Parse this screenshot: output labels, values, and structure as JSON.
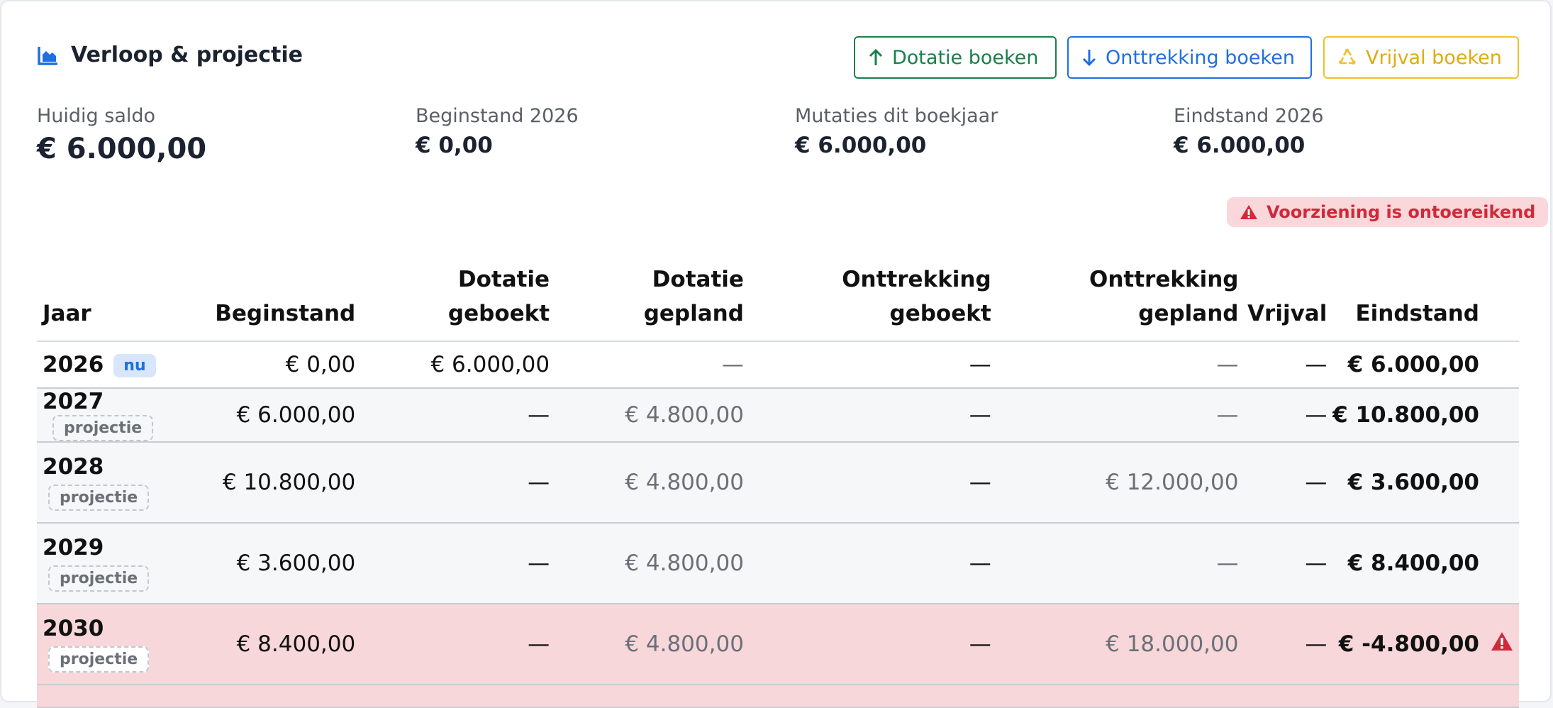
{
  "header": {
    "title": "Verloop & projectie",
    "icon": "area-chart-icon"
  },
  "actions": {
    "dotatie": "Dotatie boeken",
    "onttrekking": "Onttrekking boeken",
    "vrijval": "Vrijval boeken"
  },
  "stats": [
    {
      "label": "Huidig saldo",
      "value": "€ 6.000,00"
    },
    {
      "label": "Beginstand 2026",
      "value": "€ 0,00"
    },
    {
      "label": "Mutaties dit boekjaar",
      "value": "€ 6.000,00"
    },
    {
      "label": "Eindstand 2026",
      "value": "€ 6.000,00"
    }
  ],
  "warning": "Voorziening is ontoereikend",
  "table": {
    "headers": {
      "jaar": "Jaar",
      "beginstand": "Beginstand",
      "dotatie_geboekt_1": "Dotatie",
      "dotatie_geboekt_2": "geboekt",
      "dotatie_gepland_1": "Dotatie",
      "dotatie_gepland_2": "gepland",
      "onttrekking_geboekt_1": "Onttrekking",
      "onttrekking_geboekt_2": "geboekt",
      "onttrekking_gepland_1": "Onttrekking",
      "onttrekking_gepland_2": "gepland",
      "vrijval": "Vrijval",
      "eindstand": "Eindstand"
    },
    "rows": [
      {
        "jaar": "2026",
        "tag": "nu",
        "beginstand": "€ 0,00",
        "dotatie_geboekt": "€ 6.000,00",
        "dotatie_gepland": "—",
        "onttrekking_geboekt": "—",
        "onttrekking_gepland": "—",
        "vrijval": "—",
        "eindstand": "€ 6.000,00"
      },
      {
        "jaar": "2027",
        "tag": "projectie",
        "beginstand": "€ 6.000,00",
        "dotatie_geboekt": "—",
        "dotatie_gepland": "€ 4.800,00",
        "onttrekking_geboekt": "—",
        "onttrekking_gepland": "—",
        "vrijval": "—",
        "eindstand": "€ 10.800,00"
      },
      {
        "jaar": "2028",
        "tag": "projectie",
        "beginstand": "€ 10.800,00",
        "dotatie_geboekt": "—",
        "dotatie_gepland": "€ 4.800,00",
        "onttrekking_geboekt": "—",
        "onttrekking_gepland": "€ 12.000,00",
        "vrijval": "—",
        "eindstand": "€ 3.600,00"
      },
      {
        "jaar": "2029",
        "tag": "projectie",
        "beginstand": "€ 3.600,00",
        "dotatie_geboekt": "—",
        "dotatie_gepland": "€ 4.800,00",
        "onttrekking_geboekt": "—",
        "onttrekking_gepland": "—",
        "vrijval": "—",
        "eindstand": "€ 8.400,00"
      },
      {
        "jaar": "2030",
        "tag": "projectie",
        "beginstand": "€ 8.400,00",
        "dotatie_geboekt": "—",
        "dotatie_gepland": "€ 4.800,00",
        "onttrekking_geboekt": "—",
        "onttrekking_gepland": "€ 18.000,00",
        "vrijval": "—",
        "eindstand": "€ -4.800,00",
        "warning_icon": "warning-triangle-icon"
      }
    ]
  },
  "colors": {
    "green": "#1a7f4b",
    "blue": "#1f6fe0",
    "yellow": "#f0c02e",
    "danger": "#d0293a",
    "danger_bg": "#f7d7da"
  }
}
